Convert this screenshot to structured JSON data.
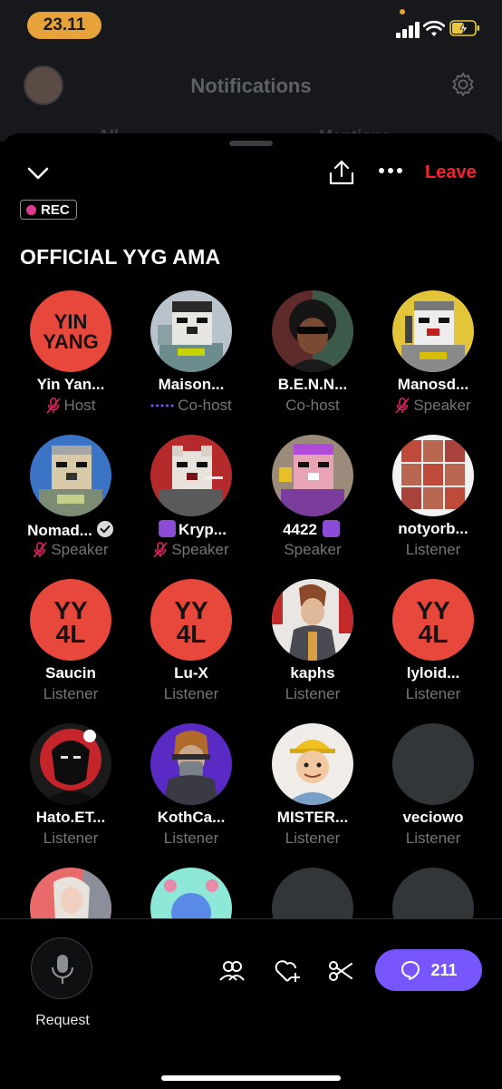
{
  "status": {
    "time": "23.11"
  },
  "background": {
    "title": "Notifications",
    "tab_a": "All",
    "tab_b": "Mentions"
  },
  "space": {
    "leave_label": "Leave",
    "rec_label": "REC",
    "title": "OFFICIAL YYG AMA"
  },
  "participants": [
    {
      "name": "Yin Yan...",
      "role": "Host",
      "muted": true,
      "avatar": "yin-yang-logo-avatar"
    },
    {
      "name": "Maison...",
      "role": "Co-host",
      "muted": false,
      "avatar": "pixel-dog-ghost-avatar"
    },
    {
      "name": "B.E.N.N...",
      "role": "Co-host",
      "muted": false,
      "avatar": "curly-hair-sunglasses-avatar"
    },
    {
      "name": "Manosd...",
      "role": "Speaker",
      "muted": true,
      "avatar": "pixel-dog-yellow-avatar"
    },
    {
      "name": "Nomad...",
      "role": "Speaker",
      "muted": true,
      "avatar": "pixel-dog-blue-avatar"
    },
    {
      "name": "Kryp...",
      "role": "Speaker",
      "muted": true,
      "avatar": "pixel-dog-red-avatar"
    },
    {
      "name": "4422",
      "role": "Speaker",
      "muted": false,
      "avatar": "pixel-dog-queen-avatar"
    },
    {
      "name": "notyorb...",
      "role": "Listener",
      "muted": false,
      "avatar": "photo-grid-avatar"
    },
    {
      "name": "Saucin",
      "role": "Listener",
      "muted": false,
      "avatar": "yy4l-logo-avatar"
    },
    {
      "name": "Lu-X",
      "role": "Listener",
      "muted": false,
      "avatar": "yy4l-logo-avatar"
    },
    {
      "name": "kaphs",
      "role": "Listener",
      "muted": false,
      "avatar": "anime-character-avatar"
    },
    {
      "name": "lyloid...",
      "role": "Listener",
      "muted": false,
      "avatar": "yy4l-logo-avatar"
    },
    {
      "name": "Hato.ET...",
      "role": "Listener",
      "muted": false,
      "avatar": "dark-ninja-avatar"
    },
    {
      "name": "KothCa...",
      "role": "Listener",
      "muted": false,
      "avatar": "cyborg-avatar"
    },
    {
      "name": "MISTER...",
      "role": "Listener",
      "muted": false,
      "avatar": "cartoon-boy-cap-avatar"
    },
    {
      "name": "veciowo",
      "role": "Listener",
      "muted": false,
      "avatar": "blank-avatar"
    }
  ],
  "bottom": {
    "request_label": "Request",
    "comment_count": "211"
  },
  "colors": {
    "accent": "#7856ff",
    "leave": "#f4212e",
    "rec_dot": "#e03a8c",
    "muted_mic": "#e0245e",
    "secondary_text": "#71767b",
    "status_pill": "#e8a23a"
  }
}
